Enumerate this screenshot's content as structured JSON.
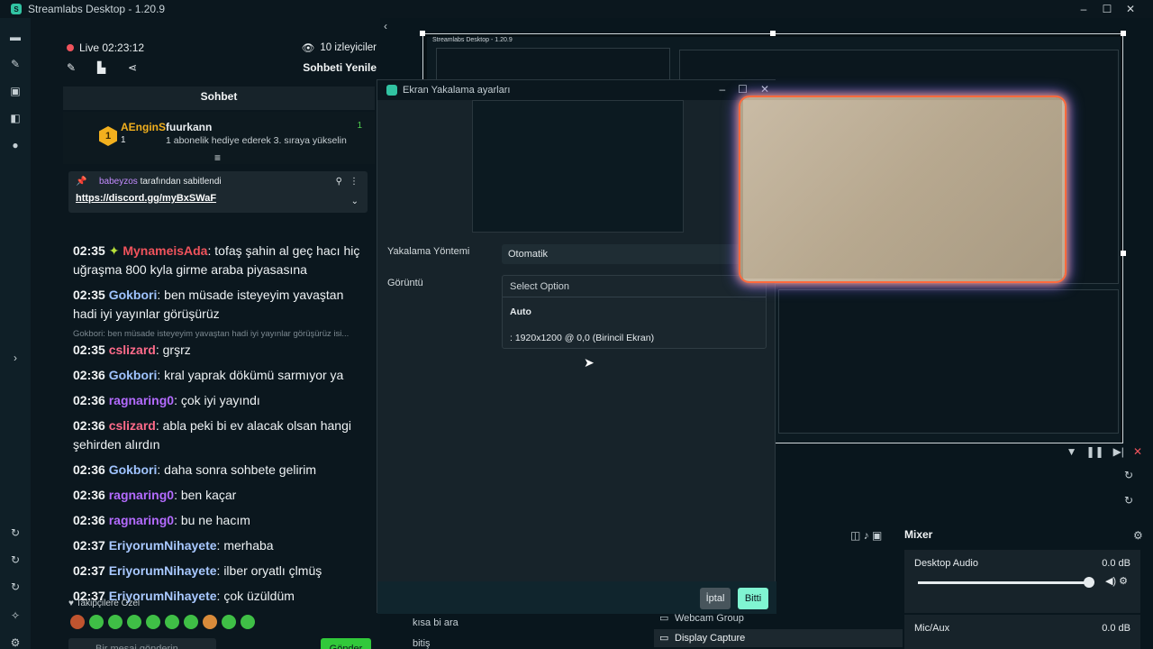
{
  "app": {
    "title": "Streamlabs Desktop - 1.20.9",
    "window_controls": [
      "–",
      "☐",
      "✕"
    ]
  },
  "chat": {
    "live": "Live 02:23:12",
    "viewers": "10 izleyiciler",
    "refresh": "Sohbeti Yenile",
    "header": "Sohbet",
    "gifter": {
      "rank": "1",
      "name": "AEnginS",
      "count": "1",
      "user": "fuurkann",
      "message": "1 abonelik hediye ederek 3. sıraya yükselin",
      "right_count": "1"
    },
    "pinned": {
      "by_user": "babeyzos",
      "by_text": " tarafından sabitlendi",
      "link": "https://discord.gg/myBxSWaF"
    },
    "messages": [
      {
        "time": "02:35",
        "user": "MynameisAda",
        "color": "#f0535c",
        "text": "tofaş şahin al geç hacı hiç uğraşma 800 kyla girme araba piyasasına"
      },
      {
        "time": "02:35",
        "user": "Gokbori",
        "color": "#9fc3ff",
        "text": "ben müsade isteyeyim yavaştan hadi iyi yayınlar görüşürüz"
      },
      {
        "reply": "Gokbori: ben müsade isteyeyim yavaştan hadi iyi yayınlar görüşürüz isi..."
      },
      {
        "time": "02:35",
        "user": "cslizard",
        "color": "#ff6b8a",
        "text": "grşrz"
      },
      {
        "time": "02:36",
        "user": "Gokbori",
        "color": "#9fc3ff",
        "text": "kral yaprak dökümü sarmıyor ya"
      },
      {
        "time": "02:36",
        "user": "ragnaring0",
        "color": "#b46bff",
        "text": "çok iyi yayındı"
      },
      {
        "time": "02:36",
        "user": "cslizard",
        "color": "#ff6b8a",
        "text": "abla peki bi ev alacak olsan hangi şehirden alırdın"
      },
      {
        "time": "02:36",
        "user": "Gokbori",
        "color": "#9fc3ff",
        "text": "daha sonra sohbete gelirim"
      },
      {
        "time": "02:36",
        "user": "ragnaring0",
        "color": "#b46bff",
        "text": "ben kaçar"
      },
      {
        "time": "02:36",
        "user": "ragnaring0",
        "color": "#b46bff",
        "text": "bu ne hacım"
      },
      {
        "time": "02:37",
        "user": "EriyorumNihayete",
        "color": "#a8c8ff",
        "text": "merhaba"
      },
      {
        "time": "02:37",
        "user": "EriyorumNihayete",
        "color": "#a8c8ff",
        "text": "ilber oryatlı çlmüş"
      },
      {
        "time": "02:37",
        "user": "EriyorumNihayete",
        "color": "#a8c8ff",
        "text": "çok üzüldüm"
      }
    ],
    "followers_only": "Takipçilere Özel",
    "input_placeholder": "Bir mesaj gönderin",
    "send": "Gönder"
  },
  "dialog": {
    "title": "Ekran Yakalama ayarları",
    "capture_method_label": "Yakalama Yöntemi",
    "capture_method_value": "Otomatik",
    "display_label": "Görüntü",
    "display_placeholder": "Select Option",
    "options": [
      "Auto",
      ": 1920x1200 @ 0,0 (Birincil Ekran)"
    ],
    "cancel": "İptal",
    "done": "Bitti"
  },
  "editor": {
    "mixer_title": "Mixer",
    "channels": [
      {
        "name": "Desktop Audio",
        "db": "0.0 dB"
      },
      {
        "name": "Mic/Aux",
        "db": "0.0 dB"
      }
    ],
    "sources": [
      "Webcam Group",
      "Display Capture"
    ],
    "scenes": [
      "kısa bi ara",
      "bitiş"
    ]
  },
  "colors": {
    "accent": "#31c3a2",
    "live": "#f0535c",
    "done_button": "#80f5d2",
    "send_button": "#31c93a"
  }
}
